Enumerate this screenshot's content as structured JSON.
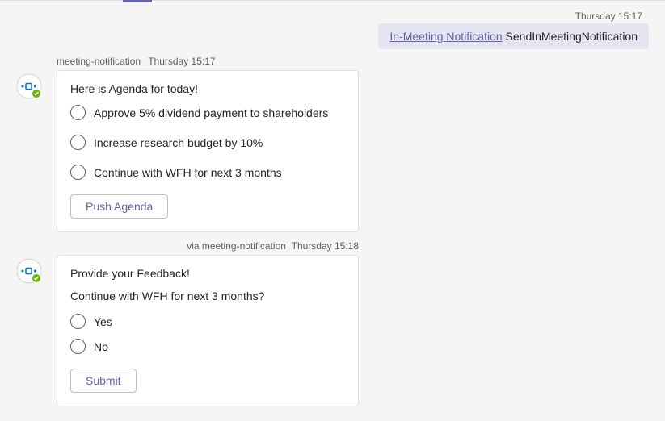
{
  "topTimestamp": "Thursday 15:17",
  "sentMessage": {
    "linkText": "In-Meeting Notification",
    "restText": " SendInMeetingNotification"
  },
  "bot1": {
    "name": "meeting-notification",
    "time": "Thursday 15:17",
    "title": "Here is Agenda for today!",
    "options": [
      "Approve 5% dividend payment to shareholders",
      "Increase research budget by 10%",
      "Continue with WFH for next 3 months"
    ],
    "button": "Push Agenda"
  },
  "bot2": {
    "via": "via meeting-notification",
    "time": "Thursday 15:18",
    "title": "Provide your Feedback!",
    "question": "Continue with WFH for next 3 months?",
    "options": [
      "Yes",
      "No"
    ],
    "button": "Submit"
  }
}
